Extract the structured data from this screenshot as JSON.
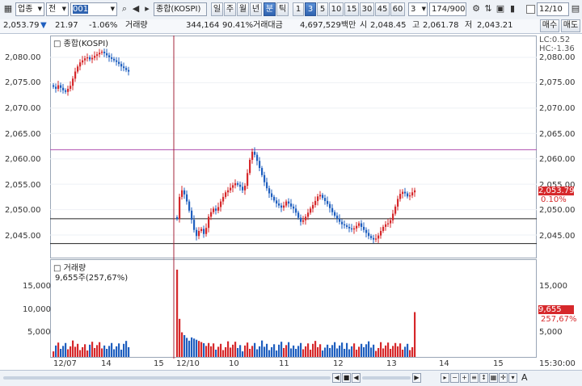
{
  "toolbar": {
    "market_select": "업종",
    "range_select": "전",
    "code_value": "001",
    "index_name": "종합(KOSPI)",
    "period_buttons": [
      "일",
      "주",
      "월",
      "년",
      "분",
      "틱"
    ],
    "selected_period": "분",
    "minute_buttons": [
      "1",
      "3",
      "5",
      "10",
      "15",
      "30",
      "45",
      "60"
    ],
    "selected_minute": "3",
    "interval_value": "3",
    "count_value": "174/900",
    "date_value": "12/10"
  },
  "info": {
    "price": "2,053.79",
    "change": "21.97",
    "change_pct": "-1.06%",
    "volume_label": "거래량",
    "volume": "344,164",
    "volume_ratio": "90.41%",
    "amount_label": "거래대금",
    "amount": "4,697,529백만",
    "open_label": "시",
    "open": "2,048.45",
    "high_label": "고",
    "high": "2,061.78",
    "low_label": "저",
    "low": "2,043.21"
  },
  "side_buttons": {
    "buy": "매수",
    "sell": "매도"
  },
  "price_pane": {
    "title": "종합(KOSPI)",
    "lc": "LC:0.52",
    "hc": "HC:-1.36",
    "y_ticks": [
      "2,080.00",
      "2,075.00",
      "2,070.00",
      "2,065.00",
      "2,060.00",
      "2,055.00",
      "2,050.00",
      "2,045.00"
    ],
    "current_tag": "2,053.79",
    "current_pct": "0.10%"
  },
  "volume_pane": {
    "title": "거래량",
    "sub": "9,655주(257,67%)",
    "y_ticks": [
      "15,000",
      "10,000",
      "5,000"
    ],
    "current_tag": "9,655",
    "current_pct": "257,67%"
  },
  "x_labels": [
    "12/07",
    "14",
    "15",
    "12/10",
    "10",
    "11",
    "12",
    "13",
    "14",
    "15"
  ],
  "time_label": "15:30:00",
  "colors": {
    "up": "#d6282b",
    "down": "#1f5fbf",
    "hline": "#b04fb0"
  },
  "chart_data": {
    "type": "candlestick",
    "price_axis": {
      "min": 2042,
      "max": 2082
    },
    "horizontal_lines": [
      2061.8,
      2048.2,
      2043.3
    ],
    "vertical_marker_label": "12/10",
    "close_path_session1": [
      2074.2,
      2073.8,
      2074.5,
      2074,
      2073.5,
      2073.2,
      2073.8,
      2074.4,
      2075.8,
      2077.2,
      2078.2,
      2079,
      2079.4,
      2079.8,
      2080,
      2079.6,
      2079.9,
      2080.3,
      2080.6,
      2080.9,
      2081.1,
      2080.8,
      2080.4,
      2080,
      2079.7,
      2079.4,
      2079.1,
      2078.7,
      2078.2,
      2077.9,
      2077.5,
      2077.2
    ],
    "close_path_session2": [
      2048.2,
      2052.5,
      2053.8,
      2053,
      2051.6,
      2049.8,
      2048,
      2046,
      2044.8,
      2045.8,
      2046.2,
      2045.2,
      2046.4,
      2048.6,
      2049.5,
      2050.2,
      2049.8,
      2050.5,
      2051.6,
      2052.5,
      2053.4,
      2053.8,
      2054.3,
      2054.8,
      2055.2,
      2054.9,
      2054.5,
      2053.8,
      2054.7,
      2057.2,
      2059.8,
      2061.4,
      2060.8,
      2059.6,
      2058.2,
      2056.8,
      2055.4,
      2054.2,
      2053.2,
      2052.5,
      2051.8,
      2051.2,
      2050.8,
      2050.4,
      2050.8,
      2051.6,
      2051.2,
      2050.6,
      2050.2,
      2049.4,
      2048.4,
      2047.6,
      2047.9,
      2048.6,
      2049.4,
      2050.2,
      2050.9,
      2051.7,
      2052.6,
      2052.9,
      2052.3,
      2051.7,
      2051.1,
      2050.3,
      2049.5,
      2048.8,
      2048.2,
      2047.6,
      2047.1,
      2046.9,
      2046.6,
      2046.3,
      2046.1,
      2046.3,
      2046.8,
      2047.3,
      2046.6,
      2046,
      2045.4,
      2044.8,
      2044.4,
      2044.1,
      2044.3,
      2044.9,
      2045.8,
      2046.6,
      2047.1,
      2047.3,
      2047.9,
      2049.2,
      2050.6,
      2052.1,
      2053.1,
      2053.5,
      2053.2,
      2052.6,
      2052.8,
      2053.4,
      2053.79
    ],
    "volume_axis": {
      "min": 0,
      "max": 20000
    },
    "volume_spike": 18800,
    "last_volume": 9655
  }
}
